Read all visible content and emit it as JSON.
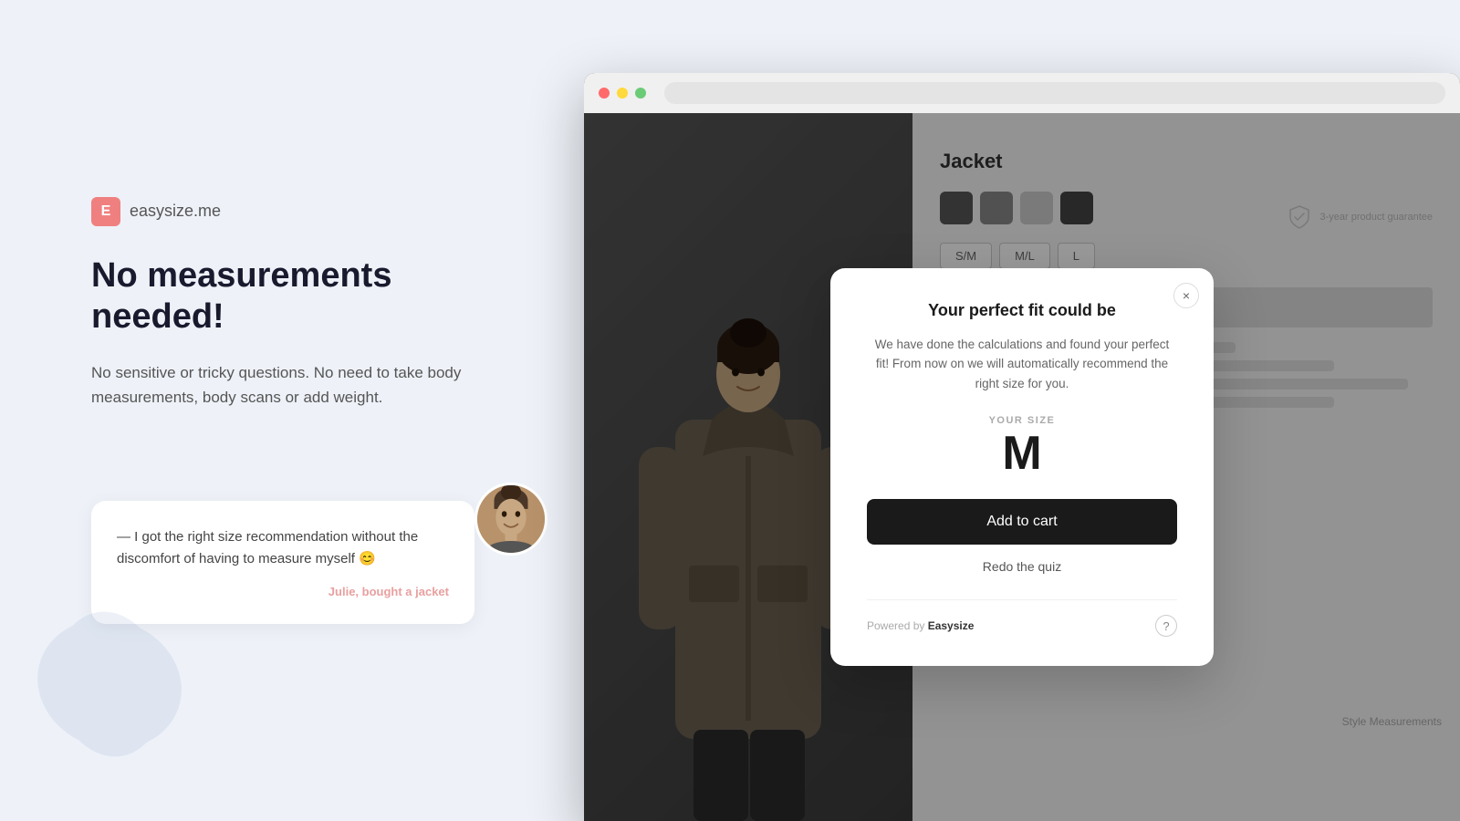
{
  "brand": {
    "icon_letter": "E",
    "name": "easysize.me"
  },
  "left": {
    "headline": "No measurements needed!",
    "subtext": "No sensitive or tricky questions. No need to take body measurements, body scans or add weight.",
    "testimonial": {
      "text": "— I got the right size recommendation without the discomfort of having to measure myself 😊",
      "author_name": "Julie",
      "author_suffix": ", bought a jacket"
    }
  },
  "browser": {
    "product": {
      "title": "Jacket"
    }
  },
  "modal": {
    "title": "Your perfect fit could be",
    "description": "We have done the calculations and found your perfect fit! From now on we will automatically recommend the right size for you.",
    "your_size_label": "YOUR SIZE",
    "size_value": "M",
    "add_to_cart_label": "Add to cart",
    "redo_quiz_label": "Redo the quiz",
    "powered_by_prefix": "Powered by ",
    "powered_by_brand": "Easysize",
    "help_symbol": "?",
    "close_symbol": "×"
  },
  "size_options": [
    "S/M",
    "M/L",
    "L"
  ],
  "color_swatches": [
    "dark",
    "dark",
    "light",
    "dark"
  ]
}
